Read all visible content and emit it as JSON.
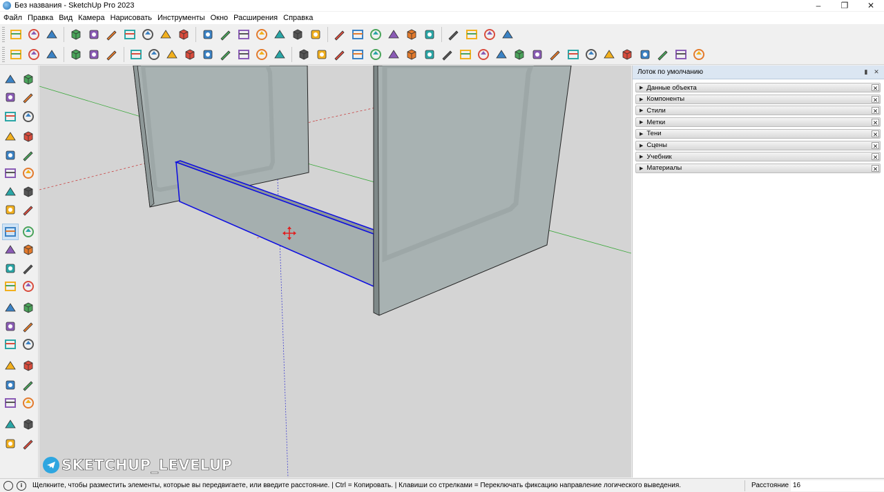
{
  "window": {
    "title": "Без названия - SketchUp Pro 2023",
    "minimize": "–",
    "maximize": "❐",
    "close": "✕"
  },
  "menu": [
    "Файл",
    "Правка",
    "Вид",
    "Камера",
    "Нарисовать",
    "Инструменты",
    "Окно",
    "Расширения",
    "Справка"
  ],
  "toolbar1_icons": [
    "walk-icon",
    "section-icon",
    "views-icon",
    "iso-view-icon",
    "top-view-icon",
    "front-view-icon",
    "right-view-icon",
    "back-view-icon",
    "left-view-icon",
    "bottom-view-icon",
    "xray-style-icon",
    "backedges-style-icon",
    "wireframe-style-icon",
    "hiddenline-style-icon",
    "shaded-style-icon",
    "textured-style-icon",
    "monochrome-style-icon",
    "section-plane-icon",
    "section-cut-icon",
    "section-fill-icon",
    "section-display-icon",
    "section-display2-icon",
    "lock-icon",
    "ocl-icon",
    "ocl-material-icon",
    "ocl-axes-icon",
    "ocl-export-icon"
  ],
  "toolbar2_icons": [
    "solid-union-icon",
    "solid-subtract-icon",
    "solid-trim-icon",
    "select-icon",
    "component-select-icon",
    "tape-icon",
    "house-icon",
    "umbrella-icon",
    "circle-target-icon",
    "triangle-icon",
    "t-icon",
    "sun-icon",
    "ring-icon",
    "cube-icon",
    "c-logo-icon",
    "pencil-icon",
    "plank-icon",
    "board-icon",
    "post-icon",
    "stack-icon",
    "box-icon",
    "ring-tag-icon",
    "paint-red-icon",
    "recycle-green-icon",
    "globe-icon",
    "axis-icon",
    "layer-icon",
    "red-arrow-icon",
    "ruler-icon",
    "drill-icon",
    "hammer-icon",
    "gear-icon",
    "tree-icon",
    "dimension-icon",
    "swap-icon",
    "box-tan-icon",
    "percent-icon",
    "telegram-icon"
  ],
  "left_tools": [
    "select-tool-icon",
    "lasso-icon",
    "paint-bucket-icon",
    "eraser-icon",
    "tag-icon",
    "eraser-2-icon",
    "line-tool-icon",
    "freehand-icon",
    "rectangle-tool-icon",
    "rotated-rect-icon",
    "circle-tool-icon",
    "polygon-icon",
    "arc-tool-icon",
    "pie-icon",
    "two-point-arc-icon",
    "three-point-arc-icon",
    "move-tool-icon",
    "push-pull-icon",
    "rotate-tool-icon",
    "follow-me-icon",
    "scale-tool-icon",
    "offset-icon",
    "tape-measure-icon",
    "protractor-icon",
    "dimension-tool-icon",
    "text-tool-icon",
    "axes-tool-icon",
    "3d-text-icon",
    "section-tool-icon",
    "orbit-icon",
    "zoom-tool-icon",
    "zoom-window-icon",
    "zoom-extents-icon",
    "previous-view-icon",
    "position-camera-icon",
    "walk-tool-icon",
    "look-around-icon",
    "section-tool-2-icon",
    "sandbox-icon",
    "smoove-icon"
  ],
  "watermark": "SKETCHUP_LEVELUP",
  "tray": {
    "title": "Лоток по умолчанию",
    "panels": [
      "Данные объекта",
      "Компоненты",
      "Стили",
      "Метки",
      "Тени",
      "Сцены",
      "Учебник",
      "Материалы"
    ]
  },
  "status": {
    "hint": "Щелкните, чтобы разместить элементы, которые вы передвигаете, или введите расстояние. | Ctrl = Копировать. | Клавиши со стрелками = Переключать фиксацию направление логического выведения.",
    "distance_label": "Расстояние",
    "distance_value": "16"
  },
  "colors": {
    "viewport_bg": "#d4d4d4",
    "panel_face": "#a9b3b3",
    "selection": "#1010e0",
    "axis_red": "#c84040",
    "axis_green": "#3aa83a",
    "axis_blue": "#3b3bd0"
  }
}
